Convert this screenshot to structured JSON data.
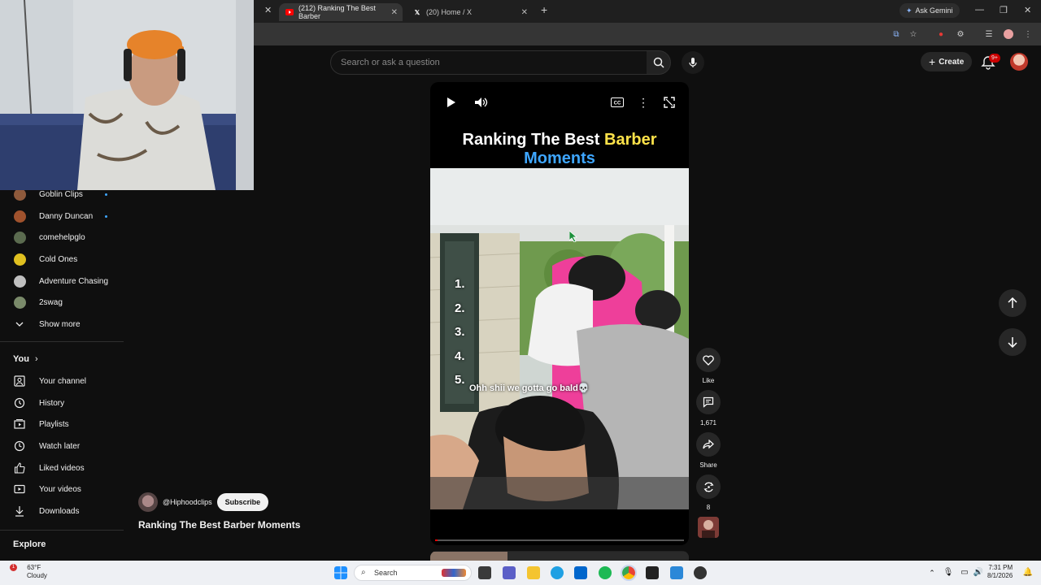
{
  "browser": {
    "tabs": [
      {
        "label": "(212) Ranking The Best Barber",
        "active": true
      },
      {
        "label": "(20) Home / X",
        "active": false
      }
    ],
    "gemini_label": "Ask Gemini"
  },
  "header": {
    "search_placeholder": "Search or ask a question",
    "create_label": "Create",
    "notifications_badge": "9+"
  },
  "sidebar": {
    "subscriptions": [
      {
        "label": "Goblin Clips",
        "new": true,
        "color": "#8e5a3c"
      },
      {
        "label": "Danny Duncan",
        "new": true,
        "color": "#a0522d"
      },
      {
        "label": "comehelpglo",
        "new": false,
        "color": "#5b6b4f"
      },
      {
        "label": "Cold Ones",
        "new": false,
        "color": "#e0c020"
      },
      {
        "label": "Adventure Chasing",
        "new": false,
        "color": "#c0c0c0"
      },
      {
        "label": "2swag",
        "new": false,
        "color": "#7a8a6a"
      }
    ],
    "show_more": "Show more",
    "you_title": "You",
    "you_items": [
      {
        "label": "Your channel",
        "icon": "person-box-icon"
      },
      {
        "label": "History",
        "icon": "history-icon"
      },
      {
        "label": "Playlists",
        "icon": "playlist-icon"
      },
      {
        "label": "Watch later",
        "icon": "clock-icon"
      },
      {
        "label": "Liked videos",
        "icon": "thumbs-up-icon"
      },
      {
        "label": "Your videos",
        "icon": "video-icon"
      },
      {
        "label": "Downloads",
        "icon": "download-icon"
      }
    ],
    "explore_title": "Explore"
  },
  "short": {
    "title_white": "Ranking The Best ",
    "title_yellow": "Barber",
    "title_blue": "Moments",
    "ranks": [
      "1.",
      "2.",
      "3.",
      "4.",
      "5."
    ],
    "caption": "Ohh shii we gotta go bald💀",
    "progress": 0.01
  },
  "actions": {
    "like_label": "Like",
    "comments_count": "1,671",
    "share_label": "Share",
    "remix_count": "8"
  },
  "channel": {
    "handle": "@Hiphoodclips",
    "subscribe_label": "Subscribe",
    "video_title": "Ranking The Best Barber Moments"
  },
  "taskbar": {
    "temperature": "63°F",
    "weather": "Cloudy",
    "search_label": "Search",
    "time": "7:31 PM",
    "date": "8/1/2026"
  }
}
